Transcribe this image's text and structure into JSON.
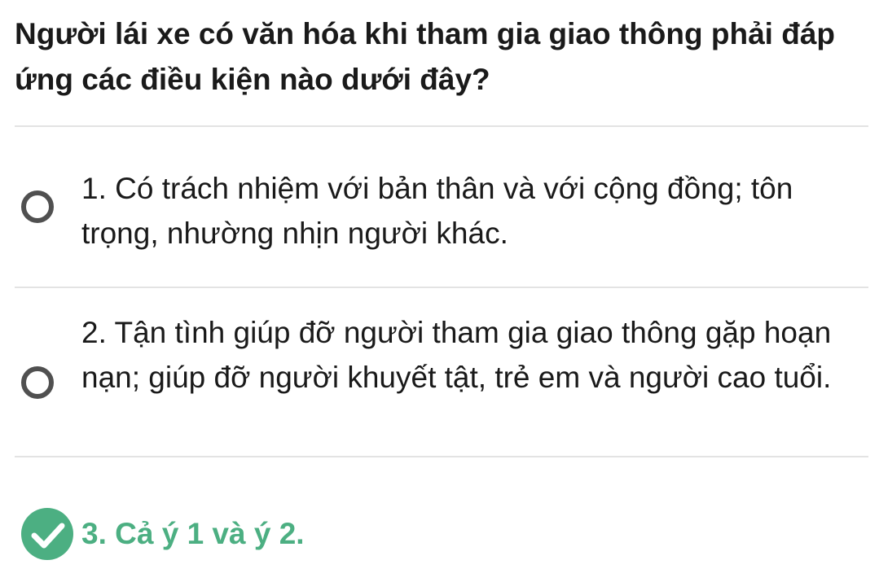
{
  "question": {
    "text": "Người lái xe có văn hóa khi tham gia giao thông phải đáp ứng các điều kiện nào dưới đây?"
  },
  "options": [
    {
      "text": "1. Có trách nhiệm với bản thân và với cộng đồng; tôn trọng, nhường nhịn người khác.",
      "selected": false,
      "icon": "radio-empty-icon"
    },
    {
      "text": "2. Tận tình giúp đỡ người tham gia giao thông gặp hoạn nạn; giúp đỡ người khuyết tật, trẻ em và người cao tuổi.",
      "selected": false,
      "icon": "radio-empty-icon"
    },
    {
      "text": "3. Cả ý 1 và ý 2.",
      "selected": true,
      "icon": "check-circle-icon"
    }
  ],
  "colors": {
    "correct": "#4caf82",
    "radio_border": "#505050",
    "divider": "#e3e3e3",
    "text": "#1a1a1a"
  }
}
